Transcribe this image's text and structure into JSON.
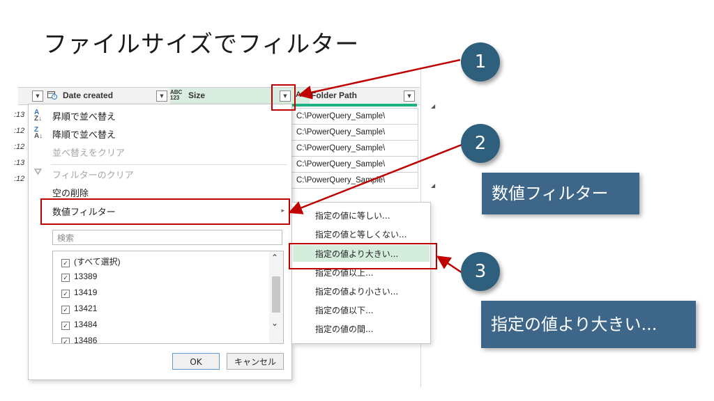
{
  "slide": {
    "title": "ファイルサイズでフィルター"
  },
  "grid": {
    "columns": [
      {
        "name": "Date created",
        "type_icon": "calendar-clock-icon"
      },
      {
        "name": "Size",
        "type_top": "ABC",
        "type_bottom": "123"
      },
      {
        "name": "Folder Path",
        "type_top": "A"
      }
    ],
    "left_fragments": [
      ":13",
      ":12",
      ":12",
      ":13",
      ":12"
    ],
    "folder_paths": [
      "C:\\PowerQuery_Sample\\",
      "C:\\PowerQuery_Sample\\",
      "C:\\PowerQuery_Sample\\",
      "C:\\PowerQuery_Sample\\",
      "C:\\PowerQuery_Sample\\"
    ]
  },
  "menu": {
    "sort_asc": "昇順で並べ替え",
    "sort_desc": "降順で並べ替え",
    "clear_sort": "並べ替えをクリア",
    "clear_filter": "フィルターのクリア",
    "remove_empty": "空の削除",
    "number_filters": "数値フィルター",
    "search_placeholder": "検索",
    "select_all": "(すべて選択)",
    "values": [
      "13389",
      "13419",
      "13421",
      "13484",
      "13486"
    ],
    "ok": "OK",
    "cancel": "キャンセル"
  },
  "submenu": {
    "items": [
      "指定の値に等しい...",
      "指定の値と等しくない...",
      "指定の値より大きい...",
      "指定の値以上...",
      "指定の値より小さい...",
      "指定の値以下...",
      "指定の値の間..."
    ],
    "highlighted_index": 2
  },
  "callouts": {
    "numbers": [
      "1",
      "2",
      "3"
    ],
    "labels": [
      "数値フィルター",
      "指定の値より大きい..."
    ]
  },
  "colors": {
    "accent_red": "#c00000",
    "callout_circle": "#2e5f7d",
    "callout_box": "#3e6689",
    "selected_column": "#d9eee0",
    "column_bar": "#1eaf82"
  }
}
